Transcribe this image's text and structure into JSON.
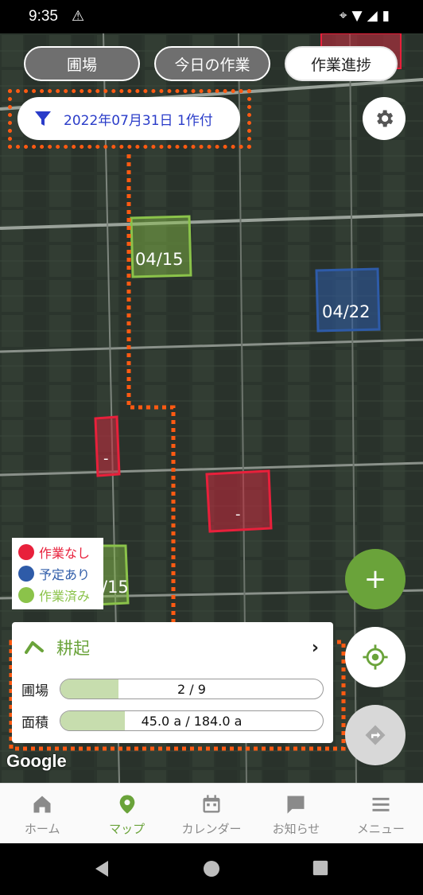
{
  "status_bar": {
    "time": "9:35",
    "warning_icon": "warning-icon",
    "icons": [
      "location-icon",
      "wifi-icon",
      "signal-icon",
      "battery-icon"
    ]
  },
  "tabs": [
    {
      "label": "圃場",
      "active": false
    },
    {
      "label": "今日の作業",
      "active": false
    },
    {
      "label": "作業進捗",
      "active": true
    }
  ],
  "filter": {
    "label": "2022年07月31日 1作付",
    "icon": "filter-icon"
  },
  "map_labels": {
    "field_a": "04/15",
    "field_b": "04/22",
    "field_c": "-",
    "field_d": "-",
    "field_e": "/15"
  },
  "legend": [
    {
      "label": "作業なし",
      "color": "#e8203b"
    },
    {
      "label": "予定あり",
      "color": "#2e5ba8"
    },
    {
      "label": "作業済み",
      "color": "#8bc34a"
    }
  ],
  "panel": {
    "title": "耕起",
    "rows": [
      {
        "label": "圃場",
        "value_text": "2  /  9",
        "progress": 0.222
      },
      {
        "label": "面積",
        "value_text": "45.0 a  /  184.0 a",
        "progress": 0.245
      }
    ]
  },
  "fab": {
    "add": "+",
    "locate_icon": "my-location-icon",
    "route_icon": "directions-icon"
  },
  "google_label": "Google",
  "nav": [
    {
      "label": "ホーム",
      "icon": "home-icon",
      "active": false
    },
    {
      "label": "マップ",
      "icon": "map-pin-icon",
      "active": true
    },
    {
      "label": "カレンダー",
      "icon": "calendar-icon",
      "active": false
    },
    {
      "label": "お知らせ",
      "icon": "message-icon",
      "active": false
    },
    {
      "label": "メニュー",
      "icon": "menu-icon",
      "active": false
    }
  ],
  "colors": {
    "accent": "#6aa33a",
    "filter_text": "#2a3cc9",
    "annotation": "#ff5a12"
  }
}
